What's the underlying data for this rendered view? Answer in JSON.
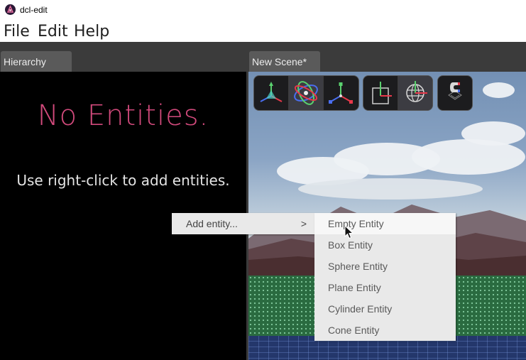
{
  "window": {
    "title": "dcl-edit"
  },
  "menubar": {
    "items": [
      "File",
      "Edit",
      "Help"
    ]
  },
  "tabs": {
    "hierarchy": "Hierarchy",
    "scene": "New Scene*"
  },
  "hierarchy": {
    "empty_title": "No Entities.",
    "empty_hint": "Use right-click to add entities."
  },
  "toolbar": {
    "groups": [
      [
        "translate-gizmo-icon",
        "rotate-gizmo-icon",
        "scale-gizmo-icon"
      ],
      [
        "local-space-icon",
        "global-space-icon"
      ],
      [
        "snap-magnet-icon"
      ]
    ],
    "active": [
      "rotate-gizmo-icon",
      "global-space-icon"
    ]
  },
  "context_menu": {
    "item": "Add entity...",
    "arrow": ">",
    "submenu": [
      "Empty Entity",
      "Box Entity",
      "Sphere Entity",
      "Plane Entity",
      "Cylinder Entity",
      "Cone Entity"
    ],
    "hovered": "Empty Entity"
  },
  "colors": {
    "accent_pink": "#d24a7c",
    "axis_x": "#e8384a",
    "axis_y": "#5ad06e",
    "axis_z": "#4a6ef0"
  }
}
